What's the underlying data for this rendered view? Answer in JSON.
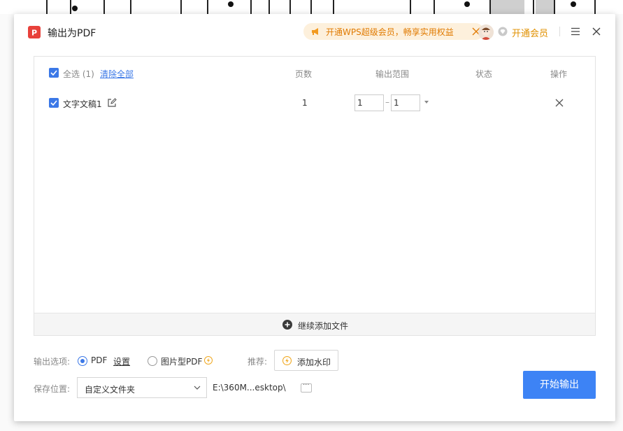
{
  "dialog": {
    "title": "输出为PDF",
    "promo_text": "开通WPS超级会员，畅享实用权益",
    "vip_label": "开通会员"
  },
  "table": {
    "select_all": "全选 (1)",
    "clear_all": "清除全部",
    "columns": [
      "页数",
      "输出范围",
      "状态",
      "操作"
    ],
    "rows": [
      {
        "name": "文字文稿1",
        "pages": "1",
        "range_from": "1",
        "range_to": "1",
        "status": ""
      }
    ],
    "add_more": "继续添加文件"
  },
  "options": {
    "output_label": "输出选项:",
    "pdf_label": "PDF",
    "settings_label": "设置",
    "image_pdf_label": "图片型PDF",
    "recommend_label": "推荐:",
    "watermark_label": "添加水印",
    "selected_format": "PDF"
  },
  "save": {
    "label": "保存位置:",
    "location": "自定义文件夹",
    "path": "E:\\360M...esktop\\",
    "browse": "···"
  },
  "start_button": "开始输出",
  "colors": {
    "accent": "#3b78e7",
    "primary_button": "#3d83f5",
    "vip": "#e07a00",
    "app_logo": "#e8413b"
  }
}
